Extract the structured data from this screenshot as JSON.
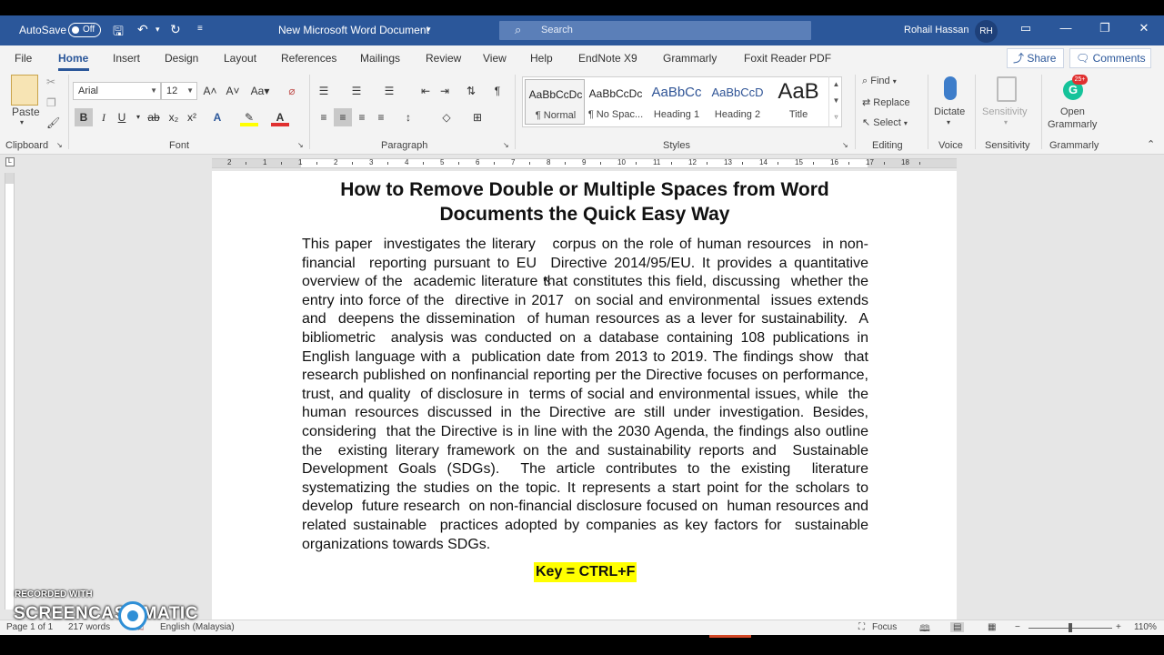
{
  "titlebar": {
    "autosave_label": "AutoSave",
    "autosave_state": "Off",
    "document_title": "New Microsoft Word Document",
    "search_placeholder": "Search",
    "user_name": "Rohail Hassan",
    "user_initials": "RH"
  },
  "tabs": [
    "File",
    "Home",
    "Insert",
    "Design",
    "Layout",
    "References",
    "Mailings",
    "Review",
    "View",
    "Help",
    "EndNote X9",
    "Grammarly",
    "Foxit Reader PDF"
  ],
  "active_tab": "Home",
  "share_label": "Share",
  "comments_label": "Comments",
  "ribbon": {
    "clipboard": {
      "paste_label": "Paste",
      "group_label": "Clipboard"
    },
    "font": {
      "font_name": "Arial",
      "font_size": "12",
      "group_label": "Font"
    },
    "paragraph": {
      "group_label": "Paragraph"
    },
    "styles": {
      "group_label": "Styles",
      "items": [
        {
          "preview": "AaBbCcDc",
          "name": "¶ Normal"
        },
        {
          "preview": "AaBbCcDc",
          "name": "¶ No Spac..."
        },
        {
          "preview": "AaBbCc",
          "name": "Heading 1"
        },
        {
          "preview": "AaBbCcD",
          "name": "Heading 2"
        },
        {
          "preview": "AaB",
          "name": "Title"
        }
      ]
    },
    "editing": {
      "find": "Find",
      "replace": "Replace",
      "select": "Select",
      "group_label": "Editing"
    },
    "voice": {
      "dictate": "Dictate",
      "group_label": "Voice"
    },
    "sensitivity": {
      "label": "Sensitivity",
      "group_label": "Sensitivity"
    },
    "grammarly": {
      "open_label": "Open",
      "app_label": "Grammarly",
      "badge": "25+",
      "group_label": "Grammarly"
    }
  },
  "ruler_numbers": [
    "2",
    "1",
    "1",
    "2",
    "3",
    "4",
    "5",
    "6",
    "7",
    "8",
    "9",
    "10",
    "11",
    "12",
    "13",
    "14",
    "15",
    "16",
    "17",
    "18"
  ],
  "document": {
    "heading": "How to Remove Double or Multiple Spaces from Word Documents the Quick Easy Way",
    "body": "This paper  investigates the literary   corpus on the role of human resources  in non-financial  reporting pursuant to EU  Directive 2014/95/EU. It provides a quantitative overview of the  academic literature that constitutes this field, discussing  whether the entry into force of the  directive in 2017  on social and environmental  issues extends and  deepens the dissemination  of human resources as a lever for sustainability.  A bibliometric  analysis was conducted on a database containing 108 publications in English language with a  publication date from 2013 to 2019. The findings show  that research published on nonfinancial reporting per the Directive focuses on performance, trust, and quality  of disclosure in  terms of social and environmental issues, while  the human resources discussed in the Directive are still under investigation. Besides, considering  that the Directive is in line with the 2030 Agenda, the findings also outline the  existing literary framework on the and sustainability reports and  Sustainable Development Goals (SDGs).  The article contributes to the existing  literature systematizing the studies on the topic. It represents a start point for the scholars to develop  future research  on non-financial disclosure focused on  human resources and related sustainable  practices adopted by companies as key factors for  sustainable organizations towards SDGs.",
    "key_text": "Key = CTRL+F"
  },
  "statusbar": {
    "page": "Page 1 of 1",
    "words": "217 words",
    "language": "English (Malaysia)",
    "focus": "Focus",
    "zoom": "110%"
  },
  "watermark": {
    "recorded_with": "RECORDED WITH",
    "brand": "SCREENCAST  MATIC"
  },
  "colors": {
    "word_blue": "#2b579a",
    "highlight": "#ffff00"
  }
}
